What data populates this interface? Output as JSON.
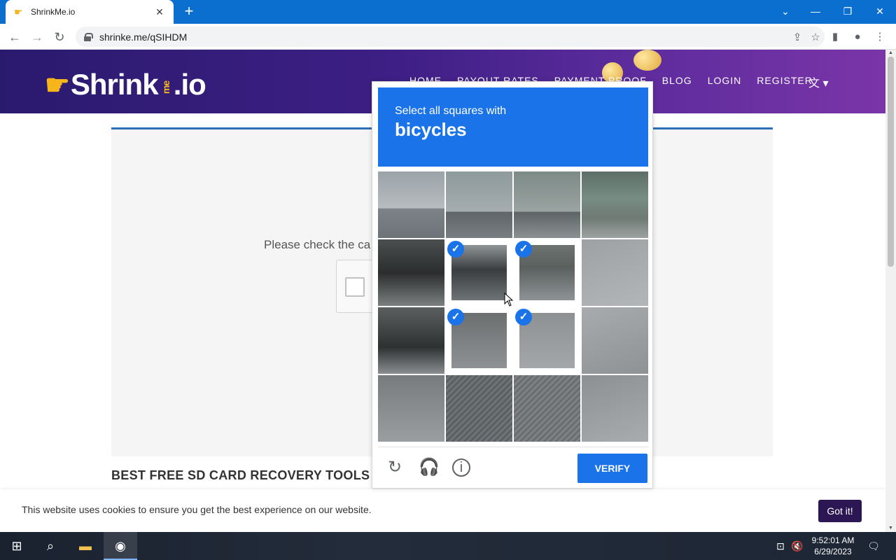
{
  "browser": {
    "tab_title": "ShrinkMe.io",
    "url": "shrinke.me/qSIHDM"
  },
  "site": {
    "logo_text": "Shrink",
    "logo_me": "me",
    "logo_suffix": ".io",
    "nav": [
      "HOME",
      "PAYOUT RATES",
      "PAYMENT PROOF",
      "BLOG",
      "LOGIN",
      "REGISTER"
    ],
    "check_text": "Please check the ca",
    "article_title": "BEST FREE SD CARD RECOVERY TOOLS",
    "cookie_text": "This website uses cookies to ensure you get the best experience on our website.",
    "cookie_button": "Got it!"
  },
  "captcha": {
    "instruction": "Select all squares with",
    "target": "bicycles",
    "tiles": [
      {
        "selected": false,
        "scene": "fence-road"
      },
      {
        "selected": false,
        "scene": "fence-person"
      },
      {
        "selected": false,
        "scene": "fence-pole"
      },
      {
        "selected": false,
        "scene": "fence-shop"
      },
      {
        "selected": false,
        "scene": "scooter"
      },
      {
        "selected": true,
        "scene": "scooter-back"
      },
      {
        "selected": true,
        "scene": "bicycle"
      },
      {
        "selected": false,
        "scene": "pavement"
      },
      {
        "selected": false,
        "scene": "scooter-wheel"
      },
      {
        "selected": true,
        "scene": "scooter-ground"
      },
      {
        "selected": true,
        "scene": "ground-bike"
      },
      {
        "selected": false,
        "scene": "bollards"
      },
      {
        "selected": false,
        "scene": "foot-ground"
      },
      {
        "selected": false,
        "scene": "grate"
      },
      {
        "selected": false,
        "scene": "bollard-grate"
      },
      {
        "selected": false,
        "scene": "pavement-corner"
      }
    ],
    "verify_label": "VERIFY"
  },
  "taskbar": {
    "time": "9:52:01 AM",
    "date": "6/29/2023"
  },
  "colors": {
    "accent": "#1a73e8",
    "header_start": "#2a1a6e",
    "header_end": "#7a35a8",
    "cookie_button": "#2d1654"
  }
}
